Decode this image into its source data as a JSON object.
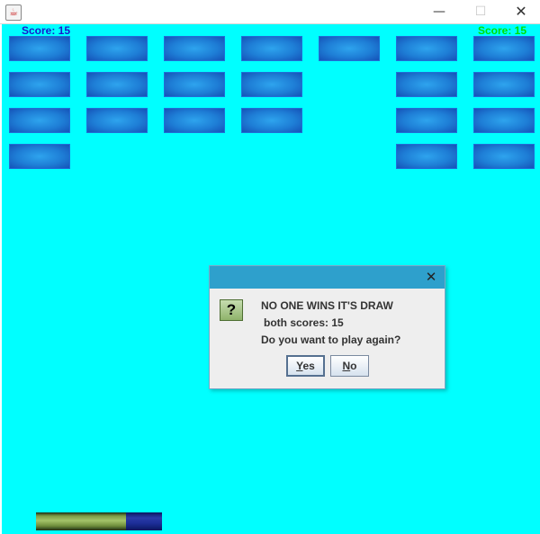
{
  "window": {
    "icon": "java-cup-icon",
    "icon_glyph": "☕",
    "minimize_glyph": "—",
    "maximize_glyph": "☐",
    "close_glyph": "✕"
  },
  "scores": {
    "left_label": "Score:  15",
    "right_label": "Score:  15",
    "left_color": "#1a1acc",
    "right_color": "#00e000"
  },
  "playfield": {
    "background_color": "#00ffff",
    "brick_color": "#1e7ed6"
  },
  "bricks": {
    "columns": 7,
    "rows": 4,
    "present": [
      [
        1,
        1,
        1,
        1,
        1,
        1,
        1
      ],
      [
        1,
        1,
        1,
        1,
        0,
        1,
        1
      ],
      [
        1,
        1,
        1,
        1,
        0,
        1,
        1
      ],
      [
        1,
        0,
        0,
        0,
        0,
        1,
        1
      ]
    ]
  },
  "dialog": {
    "close_glyph": "✕",
    "icon": "question-icon",
    "icon_glyph": "?",
    "line1": "NO ONE WINS IT'S DRAW",
    "line2": "both scores: 15",
    "line3": "Do you want to play again?",
    "yes_accel": "Y",
    "yes_rest": "es",
    "no_accel": "N",
    "no_rest": "o"
  },
  "paddle": {
    "left_color": "#8fae55",
    "right_color": "#1d2e98"
  }
}
